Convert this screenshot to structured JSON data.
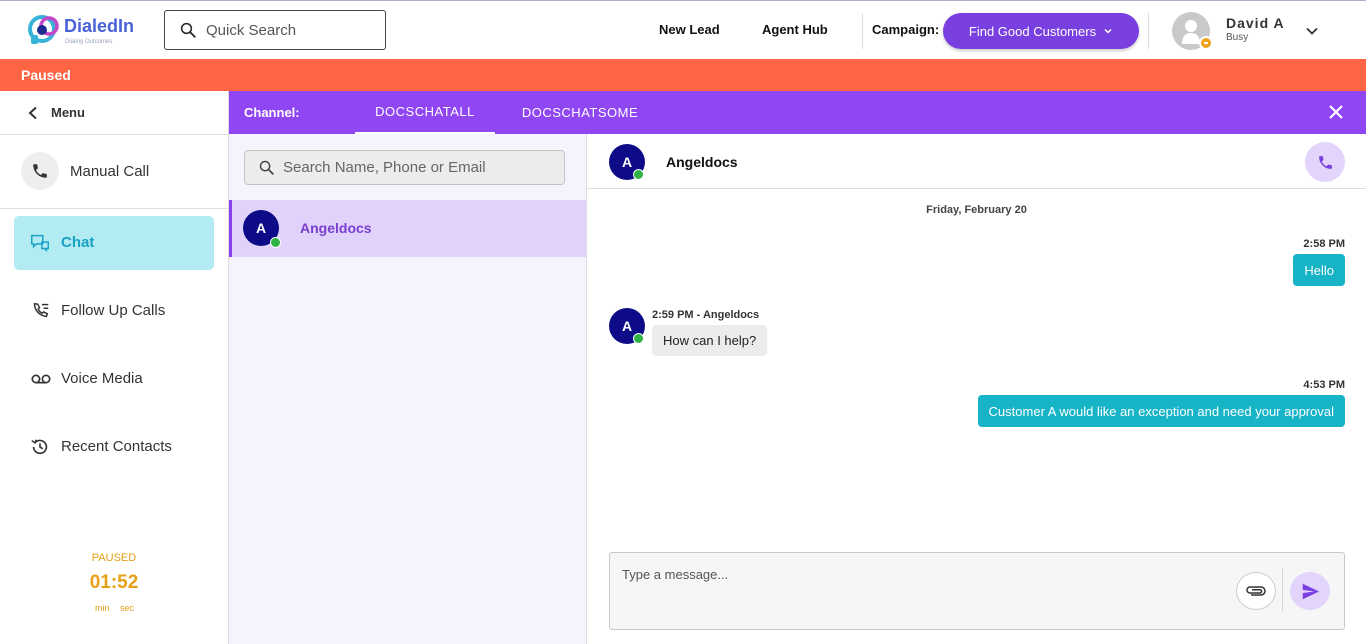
{
  "header": {
    "logo_text": "DialedIn",
    "logo_tagline": "Dialing Outcomes",
    "search_placeholder": "Quick Search",
    "links": {
      "new_lead": "New Lead",
      "agent_hub": "Agent Hub"
    },
    "campaign_label": "Campaign:",
    "campaign_value": "Find Good Customers",
    "user_name": "David A",
    "user_status": "Busy",
    "status_badge_color": "#f2a21a"
  },
  "status_bar": {
    "text": "Paused",
    "color": "#ff6445"
  },
  "sidebar": {
    "menu_label": "Menu",
    "manual_call_label": "Manual Call",
    "items": [
      {
        "label": "Chat",
        "icon": "chat-icon",
        "active": true
      },
      {
        "label": "Follow Up Calls",
        "icon": "follow-up-calls-icon",
        "active": false
      },
      {
        "label": "Voice Media",
        "icon": "voicemail-icon",
        "active": false
      },
      {
        "label": "Recent Contacts",
        "icon": "history-icon",
        "active": false
      }
    ],
    "timer": {
      "status": "PAUSED",
      "value": "01:52",
      "min_label": "min",
      "sec_label": "sec"
    }
  },
  "channel_bar": {
    "label": "Channel:",
    "tabs": [
      {
        "label": "DOCSCHATALL",
        "active": true
      },
      {
        "label": "DOCSCHATSOME",
        "active": false
      }
    ],
    "accent_color": "#9146f3"
  },
  "contacts": {
    "search_placeholder": "Search Name, Phone or Email",
    "items": [
      {
        "initial": "A",
        "name": "Angeldocs",
        "online": true
      }
    ]
  },
  "conversation": {
    "contact_initial": "A",
    "contact_name": "Angeldocs",
    "date_separator": "Friday, February 20",
    "messages": [
      {
        "direction": "out",
        "time": "2:58 PM",
        "text": "Hello"
      },
      {
        "direction": "in",
        "meta": "2:59 PM - Angeldocs",
        "initial": "A",
        "text": "How can I help?"
      },
      {
        "direction": "out",
        "time": "4:53 PM",
        "text": "Customer A would like an exception and need your approval"
      }
    ],
    "composer_placeholder": "Type a message..."
  }
}
